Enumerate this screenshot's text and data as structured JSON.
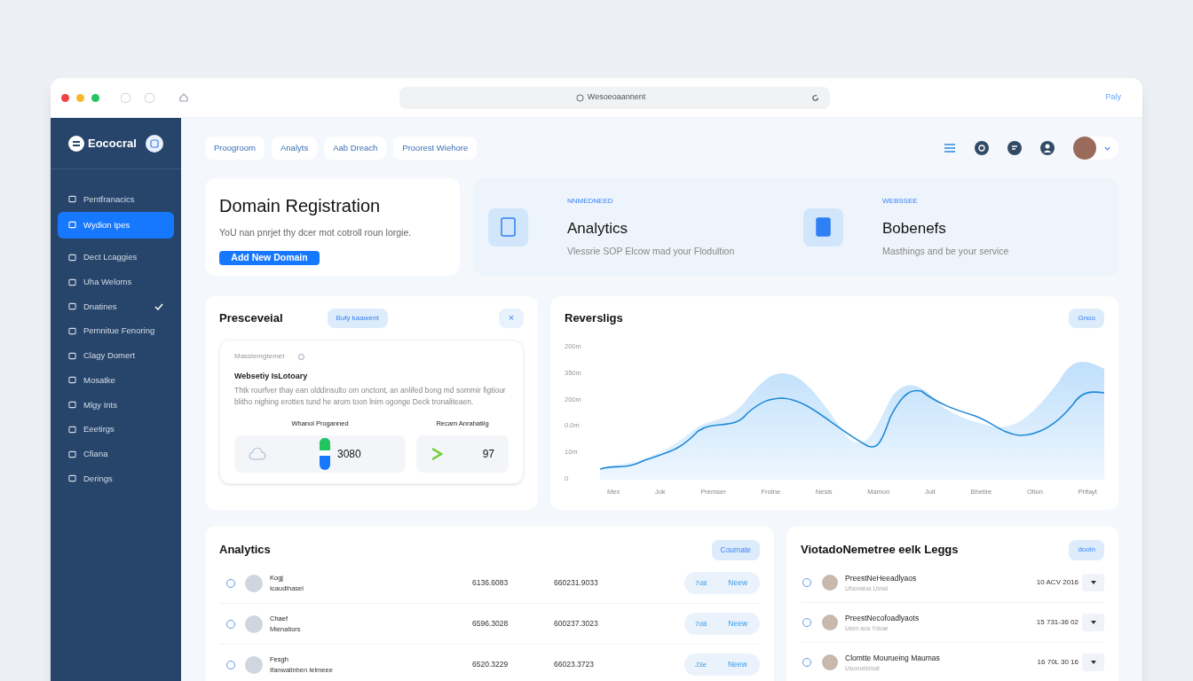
{
  "browser": {
    "address": "Wesoeoaannent",
    "right_text": "Paly"
  },
  "sidebar": {
    "brand": "Eococral",
    "items": [
      {
        "label": "Pentfranacics",
        "selected": false,
        "checked": false
      },
      {
        "label": "Wydion Ipes",
        "selected": true,
        "checked": false
      },
      {
        "label": "Dect Lcaggies",
        "selected": false,
        "checked": false
      },
      {
        "label": "Uha Weloms",
        "selected": false,
        "checked": false
      },
      {
        "label": "Dnatines",
        "selected": false,
        "checked": true
      },
      {
        "label": "Pemnitue Fenoring",
        "selected": false,
        "checked": false
      },
      {
        "label": "Clagy Domert",
        "selected": false,
        "checked": false
      },
      {
        "label": "Mosatke",
        "selected": false,
        "checked": false
      },
      {
        "label": "Mlgy Ints",
        "selected": false,
        "checked": false
      },
      {
        "label": "Eeetirgs",
        "selected": false,
        "checked": false
      },
      {
        "label": "Cfiana",
        "selected": false,
        "checked": false
      },
      {
        "label": "Derings",
        "selected": false,
        "checked": false
      }
    ]
  },
  "top_tabs": [
    "Proogroom",
    "Analyts",
    "Aab Dreach",
    "Proorest Wiehore"
  ],
  "hero": {
    "title": "Domain Registration",
    "text": "YoU nan pnrjet thy dcer mot cotroll roun lorgie.",
    "button": "Add New Domain"
  },
  "features": [
    {
      "eyebrow": "NNMEDNEED",
      "title": "Analytics",
      "text": "Vlessrie SOP Elcow mad your Flodultion"
    },
    {
      "eyebrow": "WEBSSEE",
      "title": "Bobenefs",
      "text": "Masthings and be your service"
    }
  ],
  "overview": {
    "title": "Presceveial",
    "pill": "Bufy kaawent",
    "close": "×",
    "label": "Masslemgtemet",
    "heading": "Websetiy IsLotoary",
    "text": "Thtk rourfver thay ean olddinsulto om onctont, an anlifed bong md sommir figtiour blitho nighing erottes tund he arom toon lnim ogonge Deck tronaliteaen.",
    "stats": [
      {
        "label": "Whanol Proganned",
        "value": "3080"
      },
      {
        "label": "Recam Anrahatiig",
        "value": "97"
      }
    ]
  },
  "revenue": {
    "title": "Reversligs",
    "button": "Gnoo",
    "y_labels": [
      "200m",
      "350m",
      "200m",
      "0.0m",
      "10m",
      "0"
    ],
    "x_labels": [
      "Mex",
      "Jok",
      "Premser",
      "Frotne",
      "Nesis",
      "Mamon",
      "Juit",
      "Bhetire",
      "Otion",
      "Prifayt"
    ]
  },
  "analytics_table": {
    "title": "Analytics",
    "button": "Coumate",
    "rows": [
      {
        "checked": false,
        "name": "Kogj",
        "sub": "Icaudihasel",
        "column_3": "6136.6083",
        "column_4": "660231.9033",
        "column_5": "7d8",
        "action": "Neew"
      },
      {
        "checked": false,
        "name": "Chaef",
        "sub": "Mienatiors",
        "column_3": "6596.3028",
        "column_4": "600237.3023",
        "column_5": "7d8",
        "action": "Neew"
      },
      {
        "checked": false,
        "name": "Fesgh",
        "sub": "Ifanwalinhen Ielmeee",
        "column_3": "6520.3229",
        "column_4": "66023.3723",
        "column_5": "J3e",
        "action": "Neew"
      }
    ]
  },
  "list": {
    "title": "ViotadoNemetree eelk Leggs",
    "button": "dooln",
    "rows": [
      {
        "checked": false,
        "name": "PreestNeHeeadlyaos",
        "sub": "Ufoonaioa Usnal",
        "date": "10 ACV 2016"
      },
      {
        "checked": false,
        "name": "PreestNecofoadlyaots",
        "sub": "Ueen aoa Yduae",
        "date": "15 731-36 02"
      },
      {
        "checked": false,
        "name": "Clomtte Mourueing Maumas",
        "sub": "Usuvoelsnsal",
        "date": "16 70L 30 16"
      }
    ]
  }
}
